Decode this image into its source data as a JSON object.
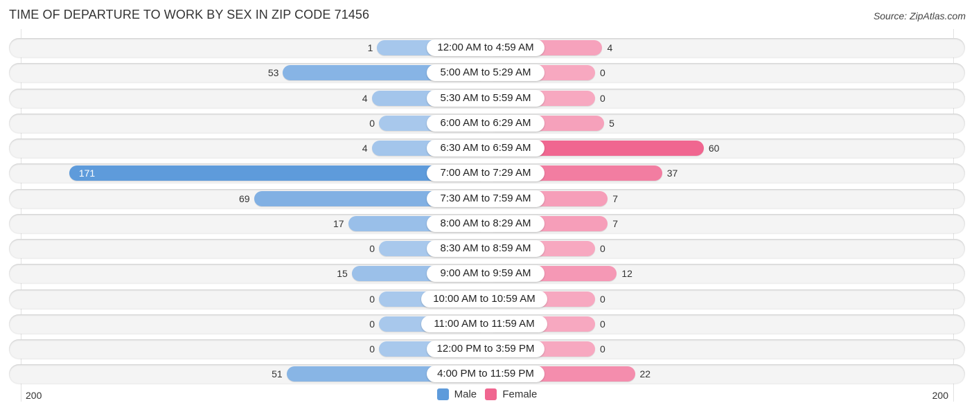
{
  "title": "TIME OF DEPARTURE TO WORK BY SEX IN ZIP CODE 71456",
  "source": "Source: ZipAtlas.com",
  "colors": {
    "male_light": "#a8c8ec",
    "male_dark": "#5e9bdb",
    "female_light": "#f7a8c0",
    "female_dark": "#f06690",
    "row_bg": "#f4f4f4"
  },
  "chart_data": {
    "type": "bar",
    "orientation": "horizontal-diverging",
    "title": "TIME OF DEPARTURE TO WORK BY SEX IN ZIP CODE 71456",
    "categories": [
      "12:00 AM to 4:59 AM",
      "5:00 AM to 5:29 AM",
      "5:30 AM to 5:59 AM",
      "6:00 AM to 6:29 AM",
      "6:30 AM to 6:59 AM",
      "7:00 AM to 7:29 AM",
      "7:30 AM to 7:59 AM",
      "8:00 AM to 8:29 AM",
      "8:30 AM to 8:59 AM",
      "9:00 AM to 9:59 AM",
      "10:00 AM to 10:59 AM",
      "11:00 AM to 11:59 AM",
      "12:00 PM to 3:59 PM",
      "4:00 PM to 11:59 PM"
    ],
    "series": [
      {
        "name": "Male",
        "values": [
          1,
          53,
          4,
          0,
          4,
          171,
          69,
          17,
          0,
          15,
          0,
          0,
          0,
          51
        ]
      },
      {
        "name": "Female",
        "values": [
          4,
          0,
          0,
          5,
          60,
          37,
          7,
          7,
          0,
          12,
          0,
          0,
          0,
          22
        ]
      }
    ],
    "xlim": [
      -200,
      200
    ],
    "axis_tick_labels": {
      "left": "200",
      "right": "200"
    },
    "legend": {
      "position": "bottom-center",
      "entries": [
        "Male",
        "Female"
      ]
    },
    "grid": false
  }
}
